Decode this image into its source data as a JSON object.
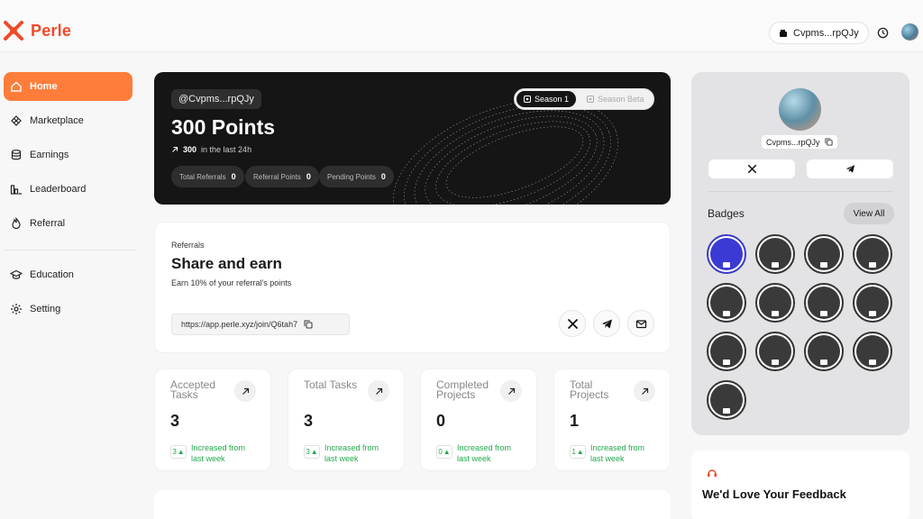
{
  "app": {
    "name": "Perle",
    "accent": "#ff7d3b",
    "brand": "#ef4a2a"
  },
  "topbar": {
    "wallet": "Cvpms...rpQJy",
    "wallet_icon": "wallet-icon",
    "history_icon": "clock-icon"
  },
  "sidebar": {
    "items": [
      {
        "label": "Home",
        "icon": "home-icon",
        "active": true
      },
      {
        "label": "Marketplace",
        "icon": "marketplace-icon"
      },
      {
        "label": "Earnings",
        "icon": "coins-icon"
      },
      {
        "label": "Leaderboard",
        "icon": "leaderboard-icon"
      },
      {
        "label": "Referral",
        "icon": "referral-icon"
      },
      {
        "label": "Education",
        "icon": "graduation-cap-icon"
      },
      {
        "label": "Setting",
        "icon": "gear-icon"
      }
    ]
  },
  "hero": {
    "handle": "@Cvpms...rpQJy",
    "points": "300 Points",
    "last24_value": "300",
    "last24_text": "in the last 24h",
    "stats": [
      {
        "label": "Total Referrals",
        "value": "0"
      },
      {
        "label": "Referral Points",
        "value": "0"
      },
      {
        "label": "Pending Points",
        "value": "0"
      }
    ],
    "season_active": "Season 1",
    "season_other": "Season Beta"
  },
  "referral": {
    "eyebrow": "Referrals",
    "title": "Share and earn",
    "subtitle": "Earn 10% of your referral's points",
    "link": "https://app.perle.xyz/join/Q6tah7"
  },
  "stats": [
    {
      "title": "Accepted Tasks",
      "value": "3",
      "delta": "3",
      "note": "Increased from last week"
    },
    {
      "title": "Total Tasks",
      "value": "3",
      "delta": "3",
      "note": "Increased from last week"
    },
    {
      "title": "Completed Projects",
      "value": "0",
      "delta": "0",
      "note": "Increased from last week"
    },
    {
      "title": "Total Projects",
      "value": "1",
      "delta": "1",
      "note": "Increased from last week"
    }
  ],
  "profile": {
    "name": "Cvpms...rpQJy",
    "badges_label": "Badges",
    "view_all": "View All",
    "badge_count": 13
  },
  "feedback": {
    "title": "We'd Love Your Feedback"
  }
}
